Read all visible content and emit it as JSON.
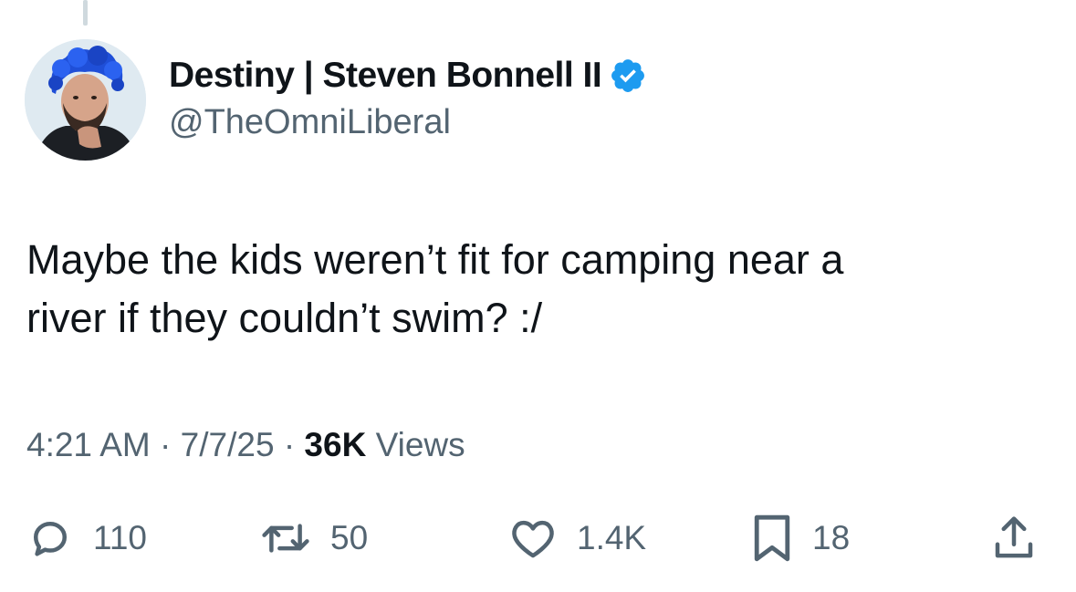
{
  "author": {
    "display_name": "Destiny | Steven Bonnell II",
    "handle": "@TheOmniLiberal",
    "verified": true,
    "verified_color": "#1d9bf0"
  },
  "tweet": {
    "line1": "Maybe the kids weren’t fit for camping near a",
    "line2": "river if they couldn’t swim? :/"
  },
  "meta": {
    "time": "4:21 AM",
    "sep1": "·",
    "date": "7/7/25",
    "sep2": "·",
    "views_count": "36K",
    "views_label": "Views"
  },
  "actions": {
    "replies": {
      "icon": "reply-icon",
      "count": "110"
    },
    "reposts": {
      "icon": "repost-icon",
      "count": "50"
    },
    "likes": {
      "icon": "like-icon",
      "count": "1.4K"
    },
    "bookmarks": {
      "icon": "bookmark-icon",
      "count": "18"
    },
    "share": {
      "icon": "share-icon"
    }
  },
  "colors": {
    "text_primary": "#0f1419",
    "text_secondary": "#536471",
    "thread_line": "#cfd9de",
    "avatar_hair": "#1f4fd8"
  }
}
